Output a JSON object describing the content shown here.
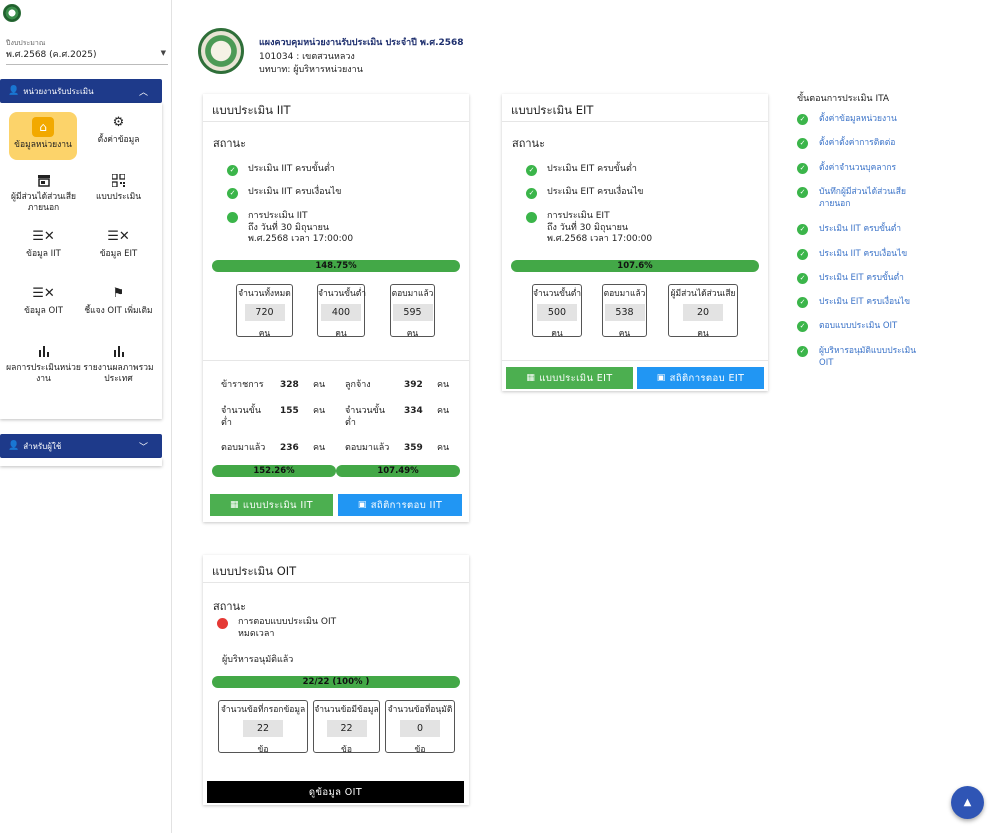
{
  "sidebar": {
    "year_label": "ปีงบประมาณ",
    "year_value": "พ.ศ.2568 (ค.ศ.2025)",
    "units_header": "หน่วยงานรับประเมิน",
    "admin_header": "สำหรับผู้ใช้",
    "menu": [
      {
        "label": "ข้อมูลหน่วยงาน",
        "icon": "home-icon"
      },
      {
        "label": "ตั้งค่าข้อมูล",
        "icon": "settings-icon"
      },
      {
        "label": "ผู้มีส่วนได้ส่วนเสียภายนอก",
        "icon": "store-icon"
      },
      {
        "label": "แบบประเมิน",
        "icon": "qr-icon"
      },
      {
        "label": "ข้อมูล IIT",
        "icon": "checklist-icon"
      },
      {
        "label": "ข้อมูล EIT",
        "icon": "checklist-icon"
      },
      {
        "label": "ข้อมูล OIT",
        "icon": "checklist-icon"
      },
      {
        "label": "ชี้แจง OIT เพิ่มเติม",
        "icon": "flag-icon"
      },
      {
        "label": "ผลการประเมินหน่วยงาน",
        "icon": "bar-chart-icon"
      },
      {
        "label": "รายงานผลภาพรวมประเทศ",
        "icon": "bar-chart-icon"
      }
    ]
  },
  "header": {
    "title": "แผงควบคุมหน่วยงานรับประเมิน ประจำปี พ.ศ.2568",
    "org": "101034 : เขตสวนหลวง",
    "role": "บทบาท: ผู้บริหารหน่วยงาน"
  },
  "iit": {
    "title": "แบบประเมิน IIT",
    "status_label": "สถานะ",
    "status1": "ประเมิน IIT ครบขั้นต่ำ",
    "status2": "ประเมิน IIT ครบเงื่อนไข",
    "deadline_l1": "การประเมิน IIT",
    "deadline_l2": "ถึง วันที่ 30 มิถุนายน",
    "deadline_l3": "พ.ศ.2568 เวลา 17:00:00",
    "progress": "148.75%",
    "boxes": [
      {
        "label": "จำนวนทั้งหมด",
        "value": "720",
        "unit": "คน"
      },
      {
        "label": "จำนวนขั้นต่ำ",
        "value": "400",
        "unit": "คน"
      },
      {
        "label": "ตอบมาแล้ว",
        "value": "595",
        "unit": "คน"
      }
    ],
    "d_gov": "ข้าราชการ",
    "d_gov_v": "328",
    "d_emp": "ลูกจ้าง",
    "d_emp_v": "392",
    "d_min1": "จำนวนขั้นต่ำ",
    "d_min1_v": "155",
    "d_min2": "จำนวนขั้นต่ำ",
    "d_min2_v": "334",
    "d_ans1": "ตอบมาแล้ว",
    "d_ans1_v": "236",
    "d_ans2": "ตอบมาแล้ว",
    "d_ans2_v": "359",
    "unit": "คน",
    "pct1": "152.26%",
    "pct2": "107.49%",
    "btn_form": "แบบประเมิน IIT",
    "btn_stats": "สถิติการตอบ IIT"
  },
  "eit": {
    "title": "แบบประเมิน EIT",
    "status_label": "สถานะ",
    "status1": "ประเมิน EIT ครบขั้นต่ำ",
    "status2": "ประเมิน EIT ครบเงื่อนไข",
    "deadline_l1": "การประเมิน EIT",
    "deadline_l2": "ถึง วันที่ 30 มิถุนายน",
    "deadline_l3": "พ.ศ.2568 เวลา 17:00:00",
    "progress": "107.6%",
    "boxes": [
      {
        "label": "จำนวนขั้นต่ำ",
        "value": "500",
        "unit": "คน"
      },
      {
        "label": "ตอบมาแล้ว",
        "value": "538",
        "unit": "คน"
      },
      {
        "label": "ผู้มีส่วนได้ส่วนเสีย",
        "value": "20",
        "unit": "คน"
      }
    ],
    "btn_form": "แบบประเมิน EIT",
    "btn_stats": "สถิติการตอบ EIT"
  },
  "oit": {
    "title": "แบบประเมิน OIT",
    "status_label": "สถานะ",
    "status1_l1": "การตอบแบบประเมิน OIT",
    "status1_l2": "หมดเวลา",
    "approved": "ผู้บริหารอนุมัติแล้ว",
    "progress": "22/22 (100% )",
    "boxes": [
      {
        "label": "จำนวนข้อที่กรอกข้อมูล",
        "value": "22",
        "unit": "ข้อ"
      },
      {
        "label": "จำนวนข้อมีข้อมูล",
        "value": "22",
        "unit": "ข้อ"
      },
      {
        "label": "จำนวนข้อที่อนุมัติ",
        "value": "0",
        "unit": "ข้อ"
      }
    ],
    "btn_view": "ดูข้อมูล OIT"
  },
  "steps": {
    "title": "ขั้นตอนการประเมิน ITA",
    "items": [
      "ตั้งค่าข้อมูลหน่วยงาน",
      "ตั้งค่าตั้งค่าการติดต่อ",
      "ตั้งค่าจำนวนบุคลากร",
      "บันทึกผู้มีส่วนได้ส่วนเสียภายนอก",
      "ประเมิน IIT ครบขั้นต่ำ",
      "ประเมิน IIT ครบเงื่อนไข",
      "ประเมิน EIT ครบขั้นต่ำ",
      "ประเมิน EIT ครบเงื่อนไข",
      "ตอบแบบประเมิน OIT",
      "ผู้บริหารอนุมัติแบบประเมิน OIT"
    ]
  },
  "colors": {
    "primary": "#1e3a8a",
    "success": "#4caf50",
    "info": "#2196f3",
    "highlight": "#fcd36a",
    "danger": "#e53935"
  }
}
